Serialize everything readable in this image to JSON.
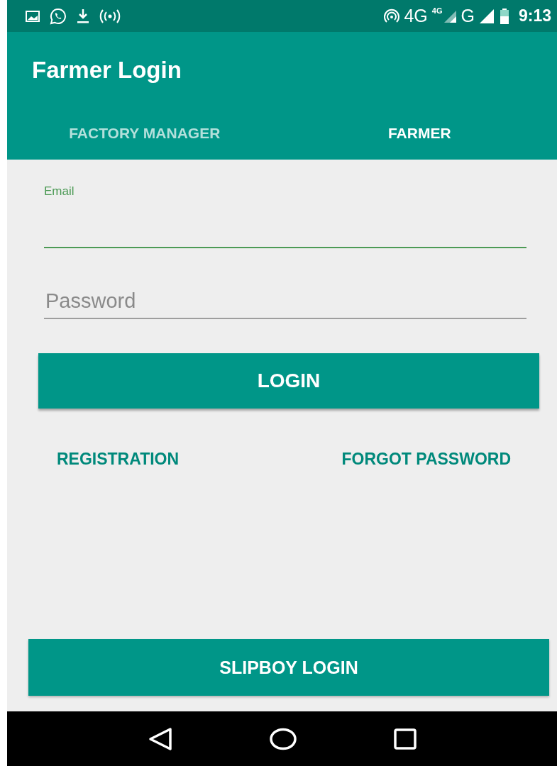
{
  "status_bar": {
    "network": "4G",
    "network_badge": "4G",
    "network_2": "G",
    "time": "9:13"
  },
  "app_bar": {
    "title": "Farmer Login"
  },
  "tabs": [
    {
      "label": "FACTORY MANAGER",
      "selected": false
    },
    {
      "label": "FARMER",
      "selected": true
    }
  ],
  "email": {
    "label": "Email",
    "focused": true
  },
  "password": {
    "placeholder": "Password",
    "focused": false
  },
  "login_button": "LOGIN",
  "links": [
    "REGISTRATION",
    "FORGOT PASSWORD"
  ],
  "slipboy_button": "SLIPBOY LOGIN"
}
